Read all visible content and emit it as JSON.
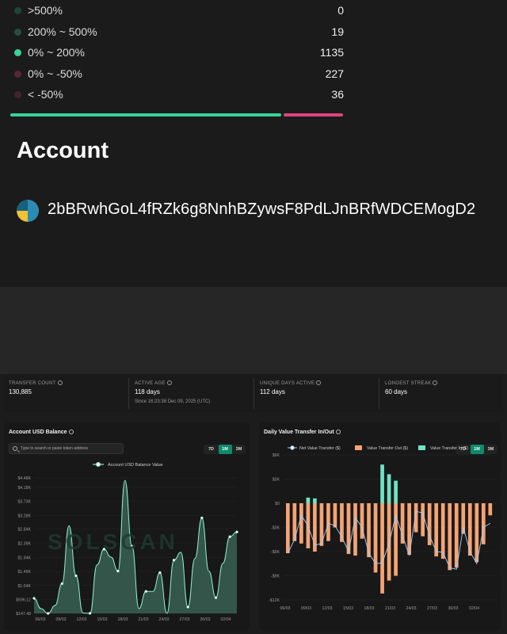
{
  "distribution": [
    {
      "label": ">500%",
      "count": "0",
      "color": "#1f4536"
    },
    {
      "label": "200% ~ 500%",
      "count": "19",
      "color": "#24513f"
    },
    {
      "label": "0% ~ 200%",
      "count": "1135",
      "color": "#37d39a"
    },
    {
      "label": "0% ~ -50%",
      "count": "227",
      "color": "#5a2536"
    },
    {
      "label": "< -50%",
      "count": "36",
      "color": "#45222d"
    }
  ],
  "distribution_bar": {
    "positive_color": "#37d39a",
    "negative_color": "#e0447b"
  },
  "account": {
    "title": "Account",
    "address": "2bBRwhGoL4fRZk6g8NnhBZywsF8PdLJnBRfWDCEMogD2",
    "logo_icon": "wallet-avatar-icon"
  },
  "stats": [
    {
      "label": "TRANSFER COUNT",
      "value": "130,885",
      "sub": ""
    },
    {
      "label": "ACTIVE AGE",
      "value": "118 days",
      "sub": "Since 16:23:38 Dec 09, 2025 (UTC)"
    },
    {
      "label": "UNIQUE DAYS ACTIVE",
      "value": "112 days",
      "sub": ""
    },
    {
      "label": "LONGEST STREAK",
      "value": "60 days",
      "sub": ""
    }
  ],
  "balance_card": {
    "title": "Account USD Balance",
    "search_placeholder": "Type to search or paste token address",
    "ranges": [
      "7D",
      "1M",
      "3M"
    ],
    "active_range": "1M",
    "watermark": "SOLSCAN"
  },
  "transfer_card": {
    "title": "Daily Value Transfer In/Out",
    "ranges": [
      "7D",
      "1M",
      "3M"
    ],
    "active_range": "1M"
  },
  "chart_data": [
    {
      "type": "area",
      "title": "Account USD Balance",
      "series": [
        {
          "name": "Account USD Balance Value",
          "color": "#7fe3c2",
          "values": [
            630,
            300,
            147,
            400,
            1100,
            2950,
            1350,
            160,
            150,
            1700,
            2200,
            1950,
            1500,
            4400,
            2300,
            300,
            850,
            850,
            1450,
            150,
            1850,
            2100,
            350,
            1900,
            3200,
            1500,
            650,
            1750,
            2600,
            2750
          ]
        }
      ],
      "x_ticks": [
        "06/03",
        "09/03",
        "12/03",
        "15/03",
        "18/03",
        "21/03",
        "24/03",
        "27/03",
        "30/03",
        "02/04"
      ],
      "y_ticks": [
        "$147.48",
        "$596.12",
        "$1.04K",
        "$1.49K",
        "$1.94K",
        "$2.39K",
        "$2.84K",
        "$3.28K",
        "$3.73K",
        "$4.18K",
        "$4.48K"
      ],
      "ylim": [
        147.48,
        4480
      ]
    },
    {
      "type": "bar",
      "title": "Daily Value Transfer In/Out",
      "x_ticks": [
        "06/03",
        "09/03",
        "12/03",
        "15/03",
        "18/03",
        "21/03",
        "24/03",
        "27/03",
        "30/03",
        "02/04"
      ],
      "y_ticks": [
        "$6K",
        "$3K",
        "$0",
        "-$3K",
        "-$6K",
        "-$9K",
        "-$12K"
      ],
      "ylim": [
        -12000,
        6000
      ],
      "series": [
        {
          "name": "Net Value Transfer ($)",
          "type": "line",
          "color": "#9fd0ff",
          "values": [
            -6200,
            -4500,
            -1500,
            -2800,
            -5200,
            -5000,
            -2500,
            -2800,
            -4200,
            -6000,
            -1800,
            -3000,
            -6200,
            -7500,
            -7400,
            -5000,
            -1500,
            -4000,
            -6500,
            -1000,
            -1200,
            -4000,
            -6000,
            -6100,
            -8000,
            -8200,
            -3000,
            -6000,
            -7500,
            -3000,
            -2500
          ]
        },
        {
          "name": "Value Transfer Out ($)",
          "type": "bar",
          "color": "#f4a474",
          "values": [
            -6200,
            -4700,
            -5000,
            -5600,
            -6000,
            -5300,
            -4700,
            -3000,
            -4800,
            -6300,
            -6500,
            -4400,
            -6700,
            -8600,
            -11200,
            -9600,
            -9000,
            -5000,
            -6400,
            -3600,
            -4100,
            -5200,
            -6600,
            -6900,
            -8300,
            -8000,
            -3800,
            -6500,
            -7300,
            -5100,
            -1500
          ]
        },
        {
          "name": "Value Transfer In ($)",
          "type": "bar",
          "color": "#6fe3c4",
          "values": [
            0,
            0,
            0,
            700,
            600,
            0,
            0,
            0,
            0,
            0,
            0,
            0,
            0,
            0,
            4800,
            3600,
            2800,
            0,
            0,
            0,
            0,
            0,
            0,
            0,
            0,
            0,
            0,
            0,
            0,
            0,
            0
          ]
        }
      ]
    }
  ]
}
